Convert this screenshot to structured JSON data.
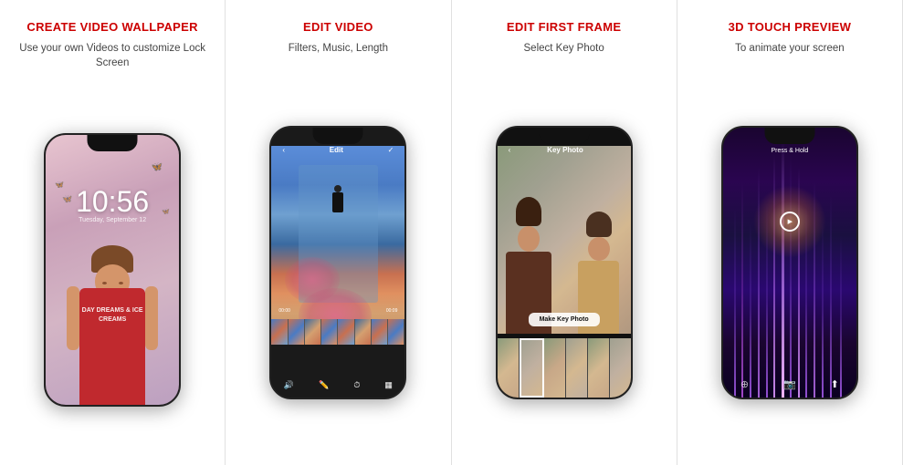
{
  "panels": [
    {
      "id": "create-video-wallpaper",
      "title": "CREATE VIDEO WALLPAPER",
      "subtitle": "Use your own Videos to customize Lock Screen",
      "screen": {
        "time": "10:56",
        "date": "Tuesday, September 12",
        "shirt_text": "DAY\nDREAMS\n&\nICE CREAMS"
      }
    },
    {
      "id": "edit-video",
      "title": "EDIT VIDEO",
      "subtitle": "Filters, Music, Length",
      "screen": {
        "nav_back": "‹",
        "nav_title": "Edit",
        "nav_confirm": "✓",
        "time_start": "00:00",
        "time_end": "00:09",
        "icons": [
          "🔊",
          "✏",
          "⏱",
          "⊞"
        ]
      }
    },
    {
      "id": "edit-first-frame",
      "title": "EDIT FIRST FRAME",
      "subtitle": "Select Key Photo",
      "screen": {
        "nav_back": "‹",
        "nav_title": "Key Photo",
        "make_key_label": "Make Key Photo"
      }
    },
    {
      "id": "3d-touch-preview",
      "title": "3D TOUCH PREVIEW",
      "subtitle": "To animate your screen",
      "screen": {
        "press_hold": "Press & Hold",
        "icons": [
          "📷",
          "⬆"
        ]
      }
    }
  ],
  "colors": {
    "title_red": "#cc0000",
    "panel_bg": "#ffffff",
    "divider": "#e0e0e0"
  }
}
